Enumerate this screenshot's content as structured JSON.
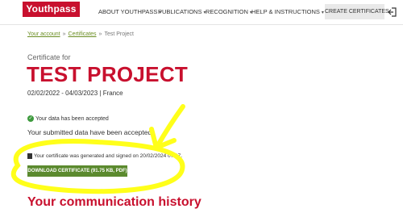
{
  "header": {
    "logo": "Youthpass",
    "nav": [
      {
        "label": "ABOUT YOUTHPASS"
      },
      {
        "label": "PUBLICATIONS"
      },
      {
        "label": "RECOGNITION"
      },
      {
        "label": "HELP & INSTRUCTIONS"
      }
    ],
    "create_label": "CREATE CERTIFICATES"
  },
  "breadcrumb": {
    "items": [
      "Your account",
      "Certificates",
      "Test Project"
    ],
    "sep": "»"
  },
  "certificate": {
    "label": "Certificate for",
    "title": "TEST PROJECT",
    "dates": "02/02/2022 - 04/03/2023 | France"
  },
  "status": {
    "badge": "Your data has been accepted",
    "message": "Your submitted data have been accepted.",
    "generated": "Your certificate was generated and signed on 20/02/2024 07:47.",
    "download_label": "DOWNLOAD CERTIFICATE (91.75 KB, PDF)"
  },
  "history": {
    "title": "Your communication history"
  },
  "colors": {
    "brand_red": "#c8102e",
    "button_green": "#5b8a2e",
    "annotation_yellow": "#ffff1a"
  }
}
